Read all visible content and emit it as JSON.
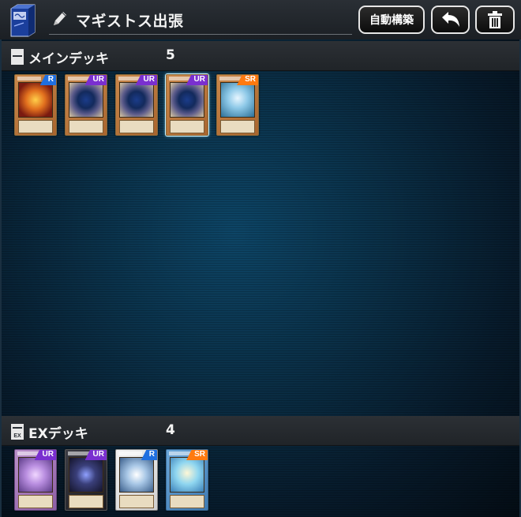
{
  "header": {
    "title": "マギストス出張",
    "auto_build_label": "自動構築",
    "icons": [
      "deck-box-icon",
      "pencil-icon",
      "undo-arrow-icon",
      "trash-icon"
    ]
  },
  "main_deck": {
    "label": "メインデッキ",
    "count": "5",
    "cards": [
      {
        "rarity": "R",
        "frame": "effect",
        "art": "fire"
      },
      {
        "rarity": "UR",
        "frame": "effect",
        "art": "portal"
      },
      {
        "rarity": "UR",
        "frame": "effect",
        "art": "portal"
      },
      {
        "rarity": "UR",
        "frame": "effect",
        "art": "portal",
        "highlighted": true
      },
      {
        "rarity": "SR",
        "frame": "effect",
        "art": "ice"
      }
    ]
  },
  "ex_deck": {
    "label": "EXデッキ",
    "icon_text": "EX",
    "count": "4",
    "cards": [
      {
        "rarity": "UR",
        "frame": "fusion",
        "art": "purple"
      },
      {
        "rarity": "UR",
        "frame": "xyz",
        "art": "dark"
      },
      {
        "rarity": "R",
        "frame": "synchro",
        "art": "crystal"
      },
      {
        "rarity": "SR",
        "frame": "ritual-blue",
        "art": "angel"
      }
    ]
  },
  "colors": {
    "rarity_R": "#1f6fe0",
    "rarity_UR": "#7a2fd0",
    "rarity_SR": "#ff7a10",
    "background": "#0a3048"
  }
}
